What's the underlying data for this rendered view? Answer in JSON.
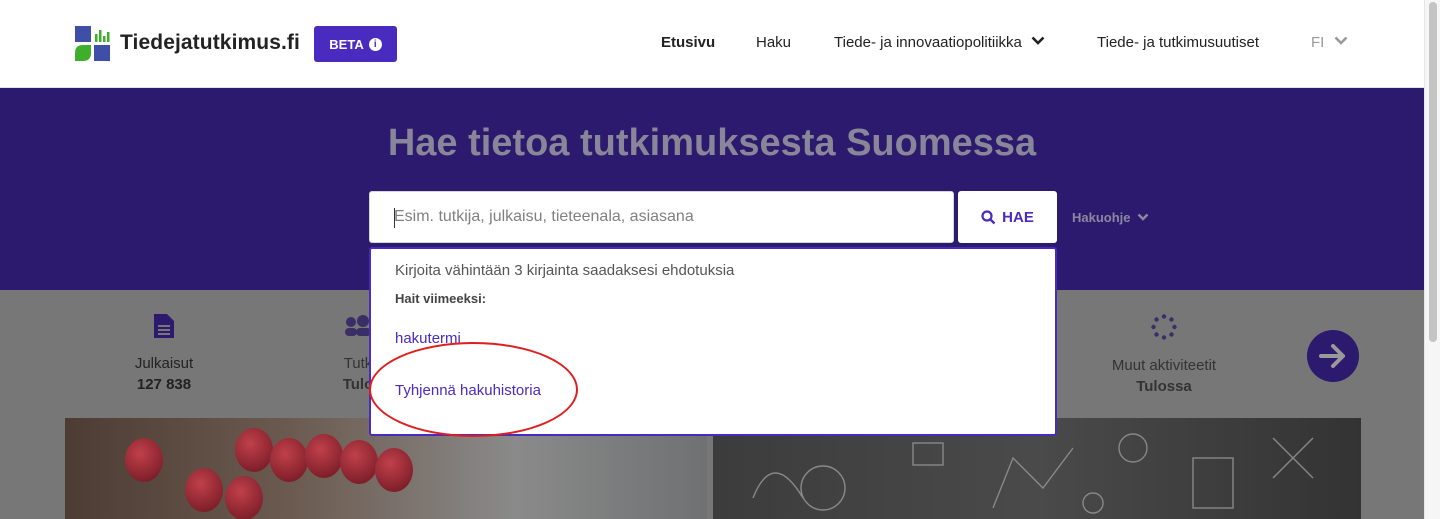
{
  "header": {
    "logo_text": "Tiedejatutkimus.fi",
    "beta_label": "BETA",
    "nav": [
      {
        "label": "Etusivu",
        "active": true
      },
      {
        "label": "Haku",
        "active": false
      },
      {
        "label": "Tiede- ja innovaatiopolitiikka",
        "has_dropdown": true
      },
      {
        "label": "Tiede- ja tutkimusuutiset",
        "active": false
      }
    ],
    "language": "FI"
  },
  "hero": {
    "title": "Hae tietoa tutkimuksesta Suomessa",
    "search_placeholder": "Esim. tutkija, julkaisu, tieteenala, asiasana",
    "search_button": "HAE",
    "help_link": "Hakuohje"
  },
  "dropdown": {
    "hint": "Kirjoita vähintään 3 kirjainta saadaksesi ehdotuksia",
    "recent_heading": "Hait viimeeksi:",
    "recent_items": [
      "hakutermi"
    ],
    "clear_history": "Tyhjennä hakuhistoria"
  },
  "stats": [
    {
      "label": "Julkaisut",
      "value": "127 838",
      "icon": "document-icon"
    },
    {
      "label": "Tutk",
      "value": "Tulo",
      "icon": "people-icon"
    },
    {
      "label": "Muut aktiviteetit",
      "value": "Tulossa",
      "icon": "spinner-icon"
    }
  ],
  "colors": {
    "brand": "#4a2bbf",
    "hero_bg": "#2b1a6e",
    "annotation": "#e01e1e"
  }
}
